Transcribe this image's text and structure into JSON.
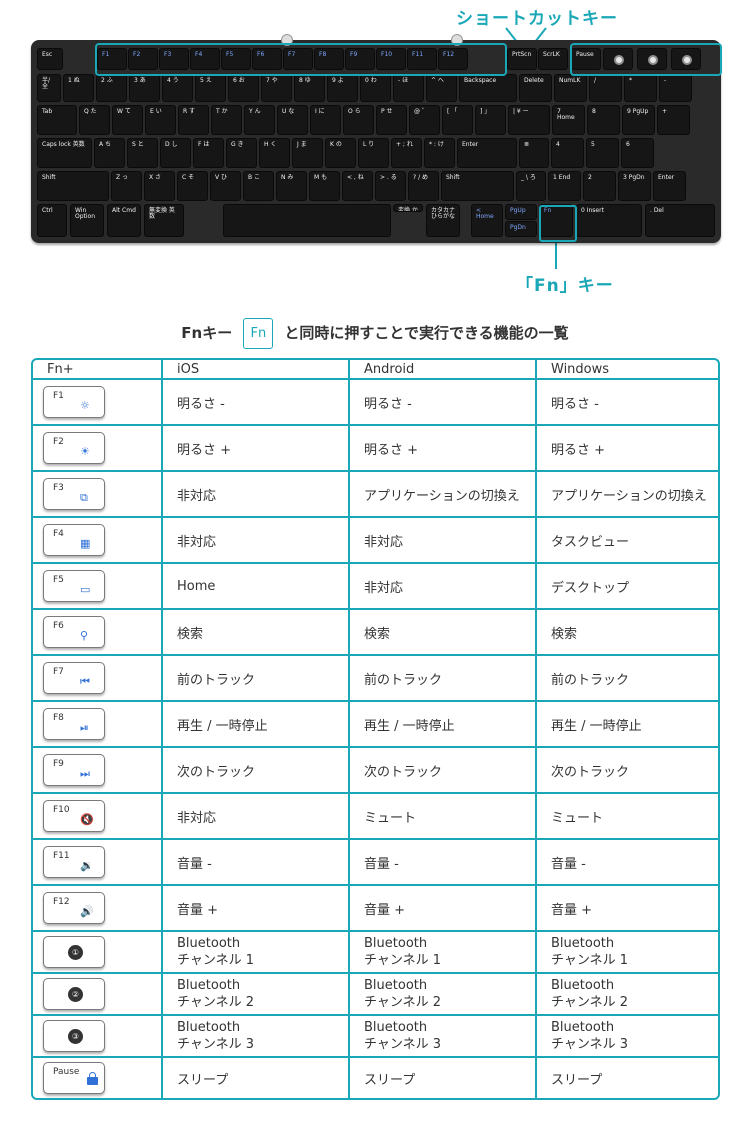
{
  "callouts": {
    "shortcut_key": "ショートカットキー",
    "fn_key": "「Fn」キー"
  },
  "keyboard": {
    "row0": [
      "Esc",
      "F1",
      "F2",
      "F3",
      "F4",
      "F5",
      "F6",
      "F7",
      "F8",
      "F9",
      "F10",
      "F11",
      "F12",
      "PrtScn",
      "ScrLK",
      "Pause"
    ],
    "row1": [
      "半/全",
      "1 ぬ",
      "2 ふ",
      "3 あ",
      "4 う",
      "5 え",
      "6 お",
      "7 や",
      "8 ゆ",
      "9 よ",
      "0 わ",
      "- ほ",
      "^ へ",
      "Backspace",
      "Delete",
      "NumLK",
      "/",
      "*",
      "-"
    ],
    "row2": [
      "Tab",
      "Q た",
      "W て",
      "E い",
      "R す",
      "T か",
      "Y ん",
      "U な",
      "I に",
      "O ら",
      "P せ",
      "@ ゛",
      "[ 「",
      "] 」",
      "| ¥ ー",
      "7 Home",
      "8",
      "9 PgUp",
      "+"
    ],
    "row3": [
      "Caps lock 英数",
      "A ち",
      "S と",
      "D し",
      "F は",
      "G き",
      "H く",
      "J ま",
      "K の",
      "L り",
      "+ ; れ",
      "* : け",
      "Enter",
      "≣",
      "4",
      "5",
      "6"
    ],
    "row4": [
      "Shift",
      "Z っ",
      "X さ",
      "C そ",
      "V ひ",
      "B こ",
      "N み",
      "M も",
      "< , ね",
      "> . る",
      "? / め",
      "Shift",
      "_ \\ ろ",
      "1 End",
      "2",
      "3 PgDn",
      "Enter"
    ],
    "row5": [
      "Ctrl",
      "Win Option",
      "Alt Cmd",
      "無変換 英数",
      "変換 かな",
      "カタカナ ひらがな",
      "< Home",
      "PgUp",
      "PgDn",
      "> End",
      "Fn",
      "0 Insert",
      ". Del"
    ]
  },
  "subtitle": {
    "before": "Fnキー",
    "badge": "Fn",
    "after": "と同時に押すことで実行できる機能の一覧"
  },
  "table": {
    "headers": [
      "Fn+",
      "iOS",
      "Android",
      "Windows"
    ],
    "rows": [
      {
        "key": "F1",
        "icon": "☼",
        "ios": "明るさ -",
        "android": "明るさ -",
        "windows": "明るさ -"
      },
      {
        "key": "F2",
        "icon": "☀",
        "ios": "明るさ +",
        "android": "明るさ +",
        "windows": "明るさ +"
      },
      {
        "key": "F3",
        "icon": "⧉",
        "ios": "非対応",
        "android": "アプリケーションの切換え",
        "windows": "アプリケーションの切換え"
      },
      {
        "key": "F4",
        "icon": "▦",
        "ios": "非対応",
        "android": "非対応",
        "windows": "タスクビュー"
      },
      {
        "key": "F5",
        "icon": "▭",
        "ios": "Home",
        "android": "非対応",
        "windows": "デスクトップ"
      },
      {
        "key": "F6",
        "icon": "⚲",
        "ios": "検索",
        "android": "検索",
        "windows": "検索"
      },
      {
        "key": "F7",
        "icon": "⏮",
        "ios": "前のトラック",
        "android": "前のトラック",
        "windows": "前のトラック"
      },
      {
        "key": "F8",
        "icon": "⏯",
        "ios": "再生 / 一時停止",
        "android": "再生 / 一時停止",
        "windows": "再生 / 一時停止"
      },
      {
        "key": "F9",
        "icon": "⏭",
        "ios": "次のトラック",
        "android": "次のトラック",
        "windows": "次のトラック"
      },
      {
        "key": "F10",
        "icon": "🔇",
        "ios": "非対応",
        "android": "ミュート",
        "windows": "ミュート"
      },
      {
        "key": "F11",
        "icon": "🔉",
        "ios": "音量 -",
        "android": "音量 -",
        "windows": "音量 -"
      },
      {
        "key": "F12",
        "icon": "🔊",
        "ios": "音量 +",
        "android": "音量 +",
        "windows": "音量 +"
      },
      {
        "key": "",
        "icon": "①",
        "ios": "Bluetooth\nチャンネル 1",
        "android": "Bluetooth\nチャンネル 1",
        "windows": "Bluetooth\nチャンネル 1"
      },
      {
        "key": "",
        "icon": "②",
        "ios": "Bluetooth\nチャンネル 2",
        "android": "Bluetooth\nチャンネル 2",
        "windows": "Bluetooth\nチャンネル 2"
      },
      {
        "key": "",
        "icon": "③",
        "ios": "Bluetooth\nチャンネル 3",
        "android": "Bluetooth\nチャンネル 3",
        "windows": "Bluetooth\nチャンネル 3"
      },
      {
        "key": "Pause",
        "icon": "lock",
        "ios": "スリープ",
        "android": "スリープ",
        "windows": "スリープ"
      }
    ]
  },
  "colors": {
    "accent": "#1aa7b7",
    "key_icon_blue": "#2f6fd6",
    "keyboard_body": "#2a2a2a"
  }
}
